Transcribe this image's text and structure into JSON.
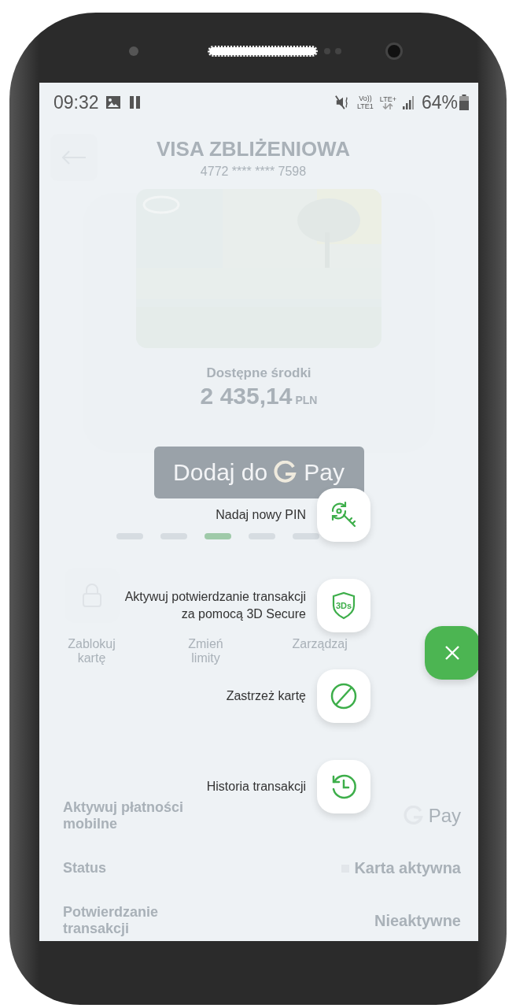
{
  "status_bar": {
    "time": "09:32",
    "volte": "Vo))",
    "lte_plus": "LTE+",
    "lte1": "LTE1",
    "battery": "64%"
  },
  "header": {
    "title": "VISA ZBLIŻENIOWA",
    "card_number": "4772 **** **** 7598"
  },
  "card": {
    "kind": "picture",
    "balance_label": "Dostępne środki",
    "balance": "2 435,14",
    "currency": "PLN"
  },
  "gpay_button": {
    "label": "Dodaj do",
    "pay": "Pay"
  },
  "pager": [
    {
      "selected": false
    },
    {
      "selected": false
    },
    {
      "selected": true
    },
    {
      "selected": false
    },
    {
      "selected": false
    }
  ],
  "actions": [
    {
      "kind": "lock",
      "label": "Zablokuj kartę"
    },
    {
      "kind": "limits",
      "label": "Zmień limity"
    },
    {
      "kind": "subscriptions",
      "label": "Zarządzaj"
    }
  ],
  "details": [
    {
      "kind": "gpay",
      "label": "Aktywuj płatności mobilne",
      "value": "Pay"
    },
    {
      "kind": "status",
      "label": "Status",
      "value": "Karta aktywna"
    },
    {
      "kind": "text",
      "label": "Potwierdzanie transakcji",
      "value": "Nieaktywne"
    }
  ],
  "menu": [
    {
      "kind": "pin",
      "label": "Nadaj nowy PIN"
    },
    {
      "kind": "secure",
      "label": "Aktywuj potwierdzanie transakcji za pomocą 3D Secure",
      "badge": "3Ds"
    },
    {
      "kind": "block",
      "label": "Zastrzeż kartę"
    },
    {
      "kind": "history",
      "label": "Historia transakcji"
    }
  ],
  "fab": {
    "expanded": true
  }
}
